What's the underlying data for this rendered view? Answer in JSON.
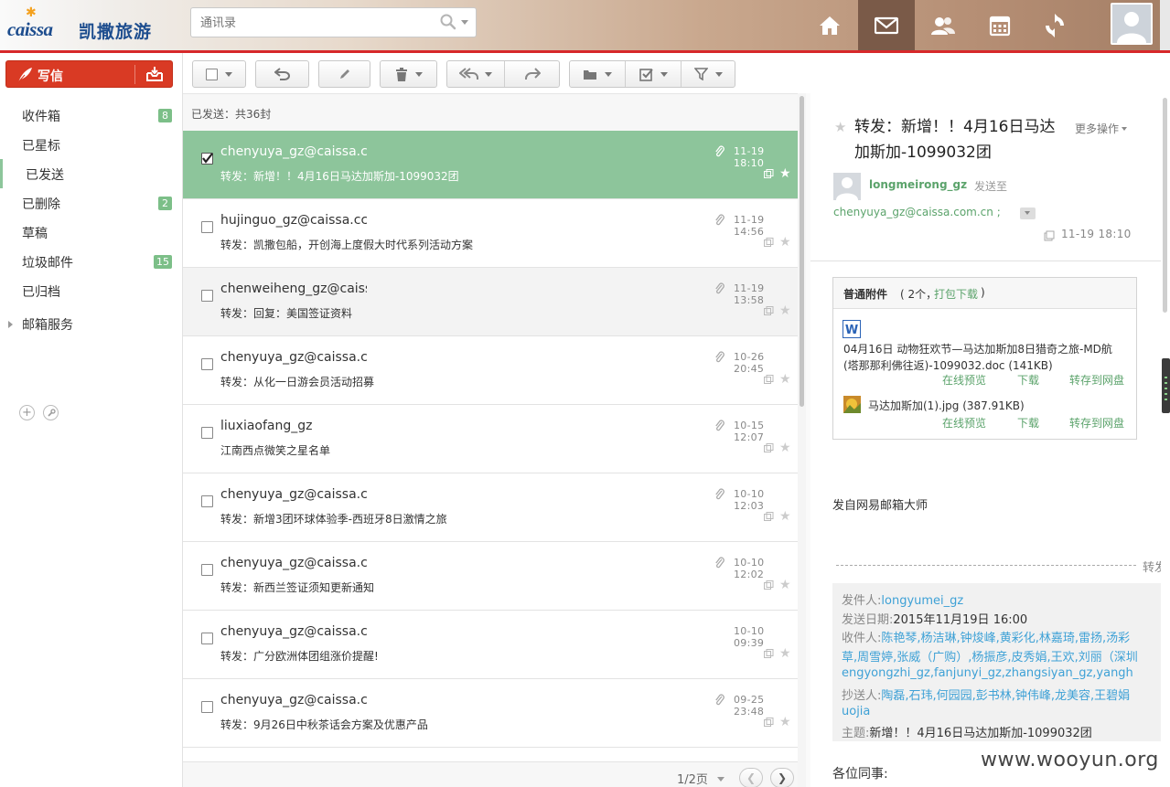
{
  "brand": {
    "latin": "caissa",
    "chinese": "凯撒旅游"
  },
  "search": {
    "placeholder": "通讯录"
  },
  "nav": [
    {
      "name": "home",
      "icon": "home-icon"
    },
    {
      "name": "mail",
      "icon": "envelope-icon",
      "active": true
    },
    {
      "name": "contacts",
      "icon": "contacts-icon"
    },
    {
      "name": "calendar",
      "icon": "calendar-icon"
    },
    {
      "name": "sync",
      "icon": "refresh-icon"
    }
  ],
  "compose": {
    "label": "写信"
  },
  "folders": [
    {
      "name": "收件箱",
      "count": "8"
    },
    {
      "name": "已星标",
      "count": ""
    },
    {
      "name": "已发送",
      "count": "",
      "active": true
    },
    {
      "name": "已删除",
      "count": "2"
    },
    {
      "name": "草稿",
      "count": ""
    },
    {
      "name": "垃圾邮件",
      "count": "15"
    },
    {
      "name": "已归档",
      "count": ""
    },
    {
      "name": "邮箱服务",
      "count": ""
    }
  ],
  "list": {
    "header": "已发送：共36封",
    "rows": [
      {
        "sender": "chenyuya_gz@caissa.c",
        "subject": "转发：新增！！4月16日马达加斯加-1099032团",
        "date": "11-19 18:10",
        "attach": true,
        "selected": true
      },
      {
        "sender": "hujinguo_gz@caissa.cc",
        "subject": "转发：凯撒包船，开创海上度假大时代系列活动方案",
        "date": "11-19 14:56",
        "attach": true
      },
      {
        "sender": "chenweiheng_gz@caiss",
        "subject": "转发：回复：美国签证资料",
        "date": "11-19 13:58",
        "attach": true,
        "hover": true
      },
      {
        "sender": "chenyuya_gz@caissa.c",
        "subject": "转发：从化一日游会员活动招募",
        "date": "10-26 20:45",
        "attach": true
      },
      {
        "sender": "liuxiaofang_gz",
        "subject": "江南西点微笑之星名单",
        "date": "10-15 12:07",
        "attach": true
      },
      {
        "sender": "chenyuya_gz@caissa.c",
        "subject": "转发：新增3团环球体验季-西班牙8日激情之旅",
        "date": "10-10 12:03",
        "attach": true
      },
      {
        "sender": "chenyuya_gz@caissa.c",
        "subject": "转发：新西兰签证须知更新通知",
        "date": "10-10 12:02",
        "attach": true
      },
      {
        "sender": "chenyuya_gz@caissa.c",
        "subject": "转发：广分欧洲体团组涨价提醒!",
        "date": "10-10 09:39",
        "attach": false
      },
      {
        "sender": "chenyuya_gz@caissa.c",
        "subject": "转发：9月26日中秋茶话会方案及优惠产品",
        "date": "09-25 23:48",
        "attach": true
      }
    ],
    "pager": "1/2页"
  },
  "reading": {
    "title": "转发：新增！！4月16日马达加斯加-1099032团",
    "more": "更多操作",
    "from": "longmeirong_gz",
    "sendto_label": "发送至",
    "to": "chenyuya_gz@caissa.com.cn ;",
    "date": "11-19 18:10",
    "attach": {
      "title": "普通附件",
      "count": "( 2个，",
      "download_all": "打包下载",
      "close": ")",
      "files": [
        {
          "name1": "04月16日 动物狂欢节—马达加斯加8日猎奇之旅-MD航",
          "name2": "(塔那那利佛往返)-1099032.doc (141KB)",
          "icon": "word-doc-icon"
        },
        {
          "name1": "马达加斯加(1).jpg (387.91KB)",
          "name2": "",
          "icon": "image-file-icon"
        }
      ],
      "actions": [
        "在线预览",
        "下载",
        "转存到网盘"
      ]
    },
    "signature": "发自网易邮箱大师",
    "fwd_label": "转发",
    "quote": {
      "from_label": "发件人:",
      "from": "longyumei_gz",
      "date_label": "发送日期:",
      "date": "2015年11月19日 16:00",
      "to_label": "收件人:",
      "to_line1": "陈艳琴,杨洁琳,钟焌峰,黄彩化,林嘉琦,雷扬,汤彩",
      "to_line2": "草,周雪婷,张威（广购）,杨振彦,皮秀娟,王欢,刘丽（深圳",
      "to_line3": "engyongzhi_gz,fanjunyi_gz,zhangsiyan_gz,yangh",
      "cc_label": "抄送人:",
      "cc_line1": "陶磊,石玮,何园园,彭书林,钟伟峰,龙美容,王碧娟",
      "cc_line2": "uojia",
      "subject_label": "主题:",
      "subject": "新增！！4月16日马达加斯加-1099032团"
    },
    "greeting": "各位同事:"
  },
  "watermark": "www.wooyun.org",
  "colors": {
    "accent_green": "#8dc59b",
    "compose_red": "#d93a24",
    "link_green": "#5ba36b",
    "link_blue": "#3ea1d6",
    "header_red": "#d7282a"
  }
}
